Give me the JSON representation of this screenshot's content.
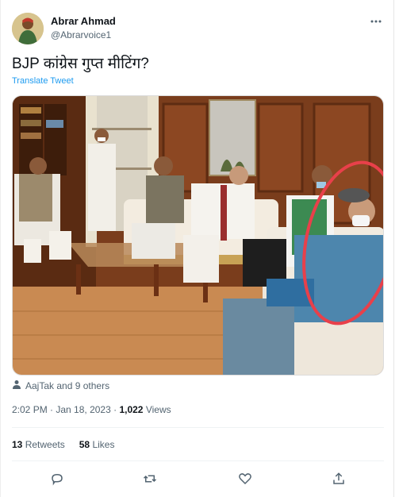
{
  "author": {
    "name": "Abrar Ahmad",
    "handle": "@Abrarvoice1"
  },
  "tweet": {
    "text": "BJP कांग्रेस गुप्त मीटिंग?",
    "translate_label": "Translate Tweet"
  },
  "media_tags": {
    "label": "AajTak and 9 others"
  },
  "timestamp": {
    "time": "2:02 PM",
    "separator1": " · ",
    "date": "Jan 18, 2023",
    "separator2": " · ",
    "views_count": "1,022",
    "views_label": "Views"
  },
  "stats": {
    "retweets_count": "13",
    "retweets_label": "Retweets",
    "likes_count": "58",
    "likes_label": "Likes"
  },
  "colors": {
    "accent": "#1d9bf0",
    "secondary_text": "#536471",
    "annotation_circle": "#e8404a"
  },
  "icons": {
    "more": "more-horizontal-icon",
    "reply": "reply-icon",
    "retweet": "retweet-icon",
    "like": "heart-icon",
    "share": "share-icon",
    "tag": "person-tag-icon"
  }
}
